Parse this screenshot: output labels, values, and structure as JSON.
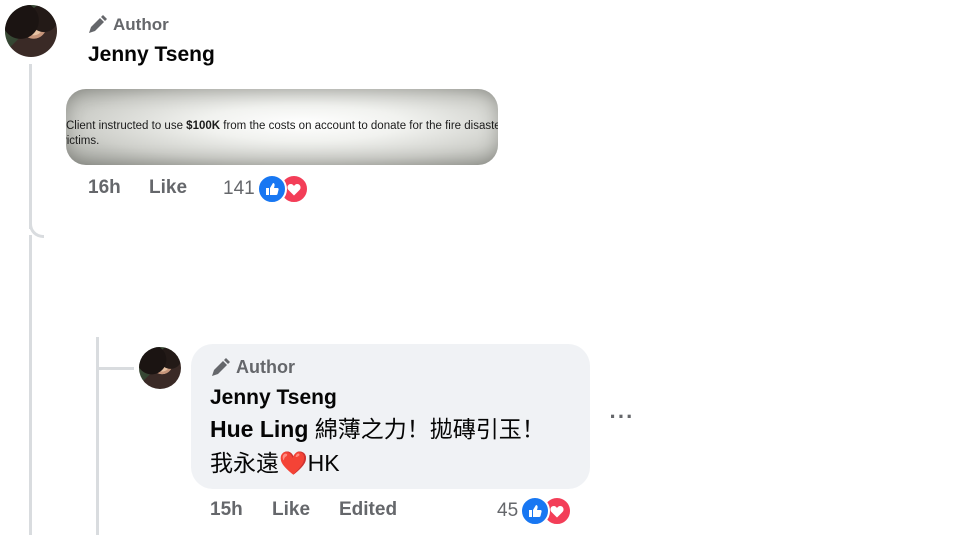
{
  "first_comment": {
    "author_badge": "Author",
    "author_icon": "pencil-icon",
    "name": "Jenny Tseng",
    "image_text_line1_prefix": "Client instructed to use ",
    "image_text_amount": "$100K",
    "image_text_line1_suffix": " from the costs on account to donate for the fire disaster",
    "image_text_line2": "victims.",
    "time": "16h",
    "like_label": "Like",
    "reaction_count": "141",
    "reaction_icons": [
      "like-icon",
      "love-icon"
    ]
  },
  "reply": {
    "author_badge": "Author",
    "author_icon": "pencil-icon",
    "name": "Jenny Tseng",
    "mention": "Hue Ling",
    "text_line1": " 綿薄之力！拋磚引玉！",
    "text_line2_prefix": "我永遠",
    "heart": "❤️",
    "text_line2_suffix": "HK",
    "time": "15h",
    "like_label": "Like",
    "edited_label": "Edited",
    "reaction_count": "45",
    "reaction_icons": [
      "like-icon",
      "love-icon"
    ],
    "more_label": "···"
  },
  "colors": {
    "meta_gray": "#65676b",
    "bubble_bg": "#f0f2f5",
    "like_blue": "#1877f2",
    "love_red": "#f33e58",
    "thread_line": "#d9dcdf"
  }
}
